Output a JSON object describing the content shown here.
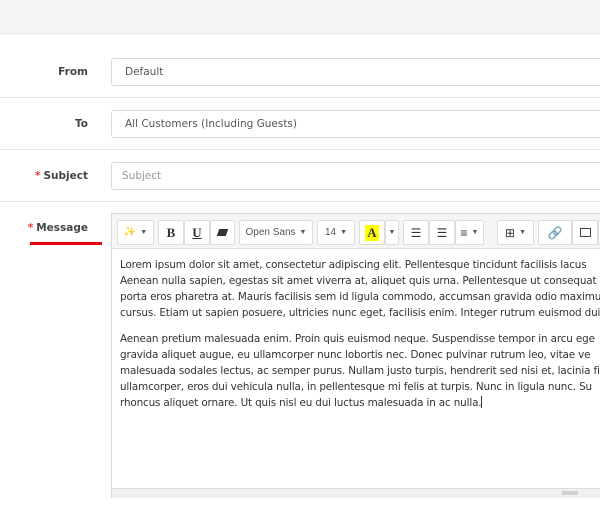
{
  "form": {
    "from": {
      "label": "From",
      "value": "Default"
    },
    "to": {
      "label": "To",
      "value": "All Customers (Including Guests)"
    },
    "subject": {
      "label": "Subject",
      "required_mark": "*",
      "placeholder": "Subject"
    },
    "message": {
      "label": "Message",
      "required_mark": "*"
    }
  },
  "toolbar": {
    "style_icon": "magic-wand-icon",
    "bold": "B",
    "underline": "U",
    "eraser_icon": "eraser-icon",
    "font": "Open Sans",
    "size": "14",
    "color_letter": "A",
    "highlight_color": "#ffff00",
    "list_icons": [
      "unordered-list-icon",
      "ordered-list-icon",
      "align-icon"
    ],
    "table_icon": "table-icon",
    "link_icon": "link-icon",
    "image_icon": "image-icon",
    "video_icon": "video-icon"
  },
  "message_body": {
    "paragraph1": [
      "Lorem ipsum dolor sit amet, consectetur adipiscing elit. Pellentesque tincidunt facilisis lacus",
      "Aenean nulla sapien, egestas sit amet viverra at, aliquet quis urna. Pellentesque ut consequat",
      "porta eros pharetra at. Mauris facilisis sem id ligula commodo, accumsan gravida odio maximu",
      "cursus. Etiam ut sapien posuere, ultricies nunc eget, facilisis enim. Integer rutrum euismod dui,"
    ],
    "paragraph2": [
      "Aenean pretium malesuada enim. Proin quis euismod neque. Suspendisse tempor in arcu ege",
      "gravida aliquet augue, eu ullamcorper nunc lobortis nec. Donec pulvinar rutrum leo, vitae ve",
      "malesuada sodales lectus, ac semper purus. Nullam justo turpis, hendrerit sed nisi et, lacinia fi",
      "ullamcorper, eros dui vehicula nulla, in pellentesque mi felis at turpis. Nunc in ligula nunc. Su",
      "rhoncus aliquet ornare. Ut quis nisl eu dui luctus malesuada in ac nulla."
    ]
  },
  "colors": {
    "accent_underline": "#e8000b",
    "required": "#e53935"
  }
}
